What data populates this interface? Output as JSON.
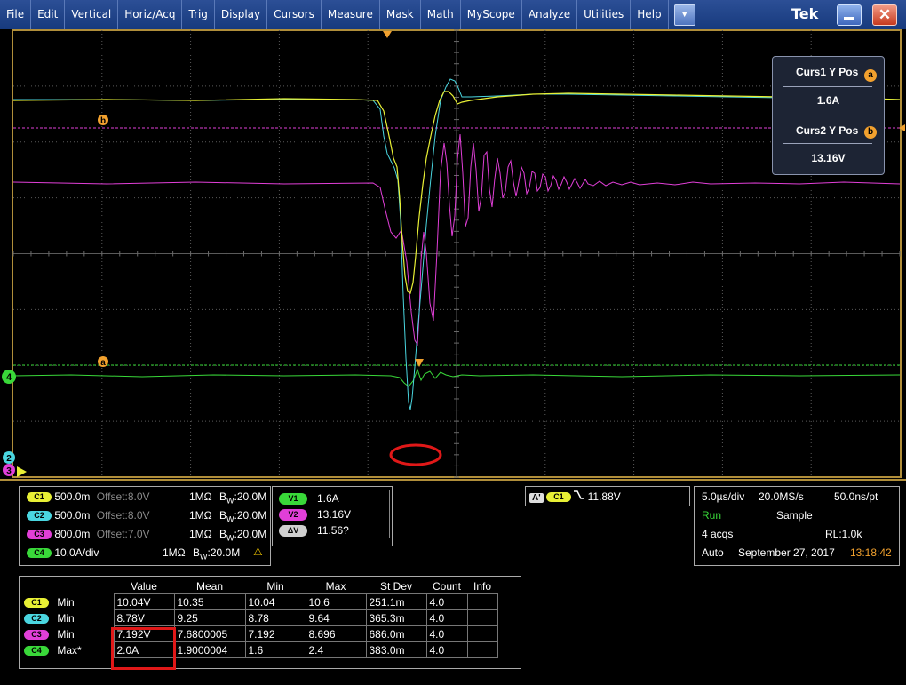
{
  "menu": {
    "items": [
      "File",
      "Edit",
      "Vertical",
      "Horiz/Acq",
      "Trig",
      "Display",
      "Cursors",
      "Measure",
      "Mask",
      "Math",
      "MyScope",
      "Analyze",
      "Utilities",
      "Help"
    ],
    "dropdown_icon": "chevron-down-icon",
    "brand": "Tek"
  },
  "cursor_readout": {
    "curs1_title": "Curs1 Y Pos",
    "curs1_badge": "a",
    "curs1_value": "1.6A",
    "curs2_title": "Curs2 Y Pos",
    "curs2_badge": "b",
    "curs2_value": "13.16V"
  },
  "waveform_markers": {
    "cursor_a": "a",
    "cursor_b": "b",
    "ch4_marker": "4",
    "ch2_marker": "2",
    "ch3_marker": "3"
  },
  "channels": [
    {
      "badge": "C1",
      "scale": "500.0m",
      "offset": "Offset:8.0V",
      "coupling": "1MΩ",
      "bw_prefix": "B",
      "bw_sub": "W",
      "bw_value": ":20.0M",
      "color": "#e8f035"
    },
    {
      "badge": "C2",
      "scale": "500.0m",
      "offset": "Offset:8.0V",
      "coupling": "1MΩ",
      "bw_prefix": "B",
      "bw_sub": "W",
      "bw_value": ":20.0M",
      "color": "#4ad6e0"
    },
    {
      "badge": "C3",
      "scale": "800.0m",
      "offset": "Offset:7.0V",
      "coupling": "1MΩ",
      "bw_prefix": "B",
      "bw_sub": "W",
      "bw_value": ":20.0M",
      "color": "#e13fd8"
    },
    {
      "badge": "C4",
      "scale": "10.0A/div",
      "offset": "",
      "coupling": "1MΩ",
      "bw_prefix": "B",
      "bw_sub": "W",
      "bw_value": ":20.0M",
      "color": "#39d839",
      "warning": "⚠"
    }
  ],
  "cursor_values": [
    {
      "badge": "V1",
      "value": "1.6A"
    },
    {
      "badge": "V2",
      "value": "13.16V"
    },
    {
      "badge": "ΔV",
      "value": "11.56?"
    }
  ],
  "trigger": {
    "a_label": "A'",
    "channel": "C1",
    "slope_icon": "falling-edge-icon",
    "level": "11.88V"
  },
  "acquisition": {
    "time_div": "5.0µs/div",
    "sample_rate": "20.0MS/s",
    "resolution": "50.0ns/pt",
    "state": "Run",
    "mode": "Sample",
    "acqs": "4 acqs",
    "record_length": "RL:1.0k",
    "trigger_mode": "Auto",
    "date": "September 27, 2017",
    "time": "13:18:42"
  },
  "measurements": {
    "headers": [
      "Value",
      "Mean",
      "Min",
      "Max",
      "St Dev",
      "Count",
      "Info"
    ],
    "rows": [
      {
        "badge": "C1",
        "type": "Min",
        "value": "10.04V",
        "mean": "10.35",
        "min": "10.04",
        "max": "10.6",
        "stdev": "251.1m",
        "count": "4.0",
        "info": ""
      },
      {
        "badge": "C2",
        "type": "Min",
        "value": "8.78V",
        "mean": "9.25",
        "min": "8.78",
        "max": "9.64",
        "stdev": "365.3m",
        "count": "4.0",
        "info": ""
      },
      {
        "badge": "C3",
        "type": "Min",
        "value": "7.192V",
        "mean": "7.6800005",
        "min": "7.192",
        "max": "8.696",
        "stdev": "686.0m",
        "count": "4.0",
        "info": ""
      },
      {
        "badge": "C4",
        "type": "Max*",
        "value": "2.0A",
        "mean": "1.9000004",
        "min": "1.6",
        "max": "2.4",
        "stdev": "383.0m",
        "count": "4.0",
        "info": ""
      }
    ]
  },
  "colors": {
    "ch1": "#e8f035",
    "ch2": "#4ad6e0",
    "ch3": "#e13fd8",
    "ch4": "#39d839",
    "cursor": "#f2a12e",
    "highlight": "#e01818"
  }
}
